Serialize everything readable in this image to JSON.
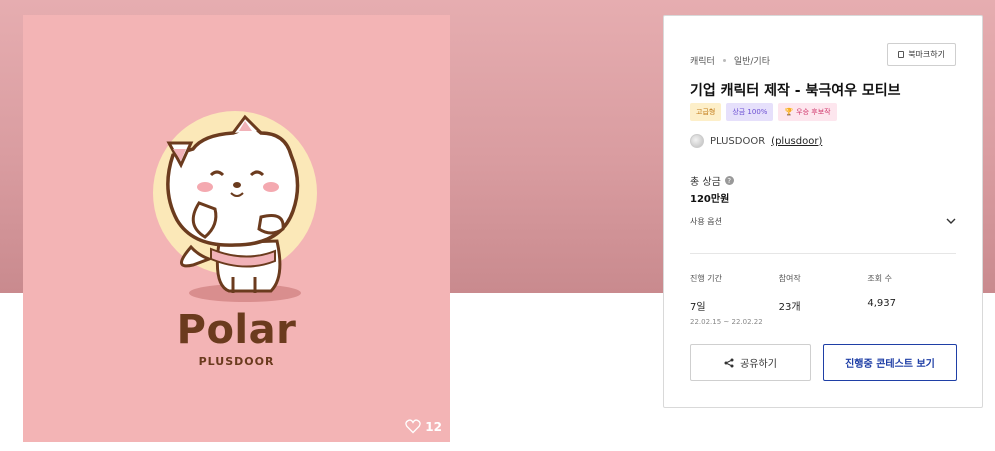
{
  "hero": {
    "mascot_word": "Polar",
    "mascot_sub": "PLUSDOOR",
    "likes_count": "12"
  },
  "panel": {
    "breadcrumb": [
      "캐릭터",
      "일반/기타"
    ],
    "bookmark_label": "북마크하기",
    "title": "기업 캐릭터 제작 - 북극여우 모티브",
    "badges": [
      "고급형",
      "상금 100%",
      "우승 후보작"
    ],
    "owner": {
      "name": "PLUSDOOR",
      "handle": "(plusdoor)"
    },
    "prize": {
      "label": "총 상금",
      "value": "120만원"
    },
    "usage_label": "사용 옵션",
    "stats": [
      {
        "label": "진행 기간",
        "value": "7일",
        "sub": "22.02.15 ~ 22.02.22"
      },
      {
        "label": "참여작",
        "value": "23개",
        "sub": ""
      },
      {
        "label": "조회 수",
        "value": "4,937",
        "sub": ""
      }
    ],
    "share_label": "공유하기",
    "contest_label": "진행중 콘테스트 보기"
  },
  "icons": [
    "heart-icon",
    "bookmark-icon",
    "trophy-icon",
    "help-icon",
    "chevron-down-icon",
    "share-icon"
  ],
  "colors": {
    "hero_bg": "#d99ca0",
    "card_bg": "#f3b4b5",
    "accent_blue": "#1f3fa6",
    "logo_brown": "#6b3b1e"
  }
}
